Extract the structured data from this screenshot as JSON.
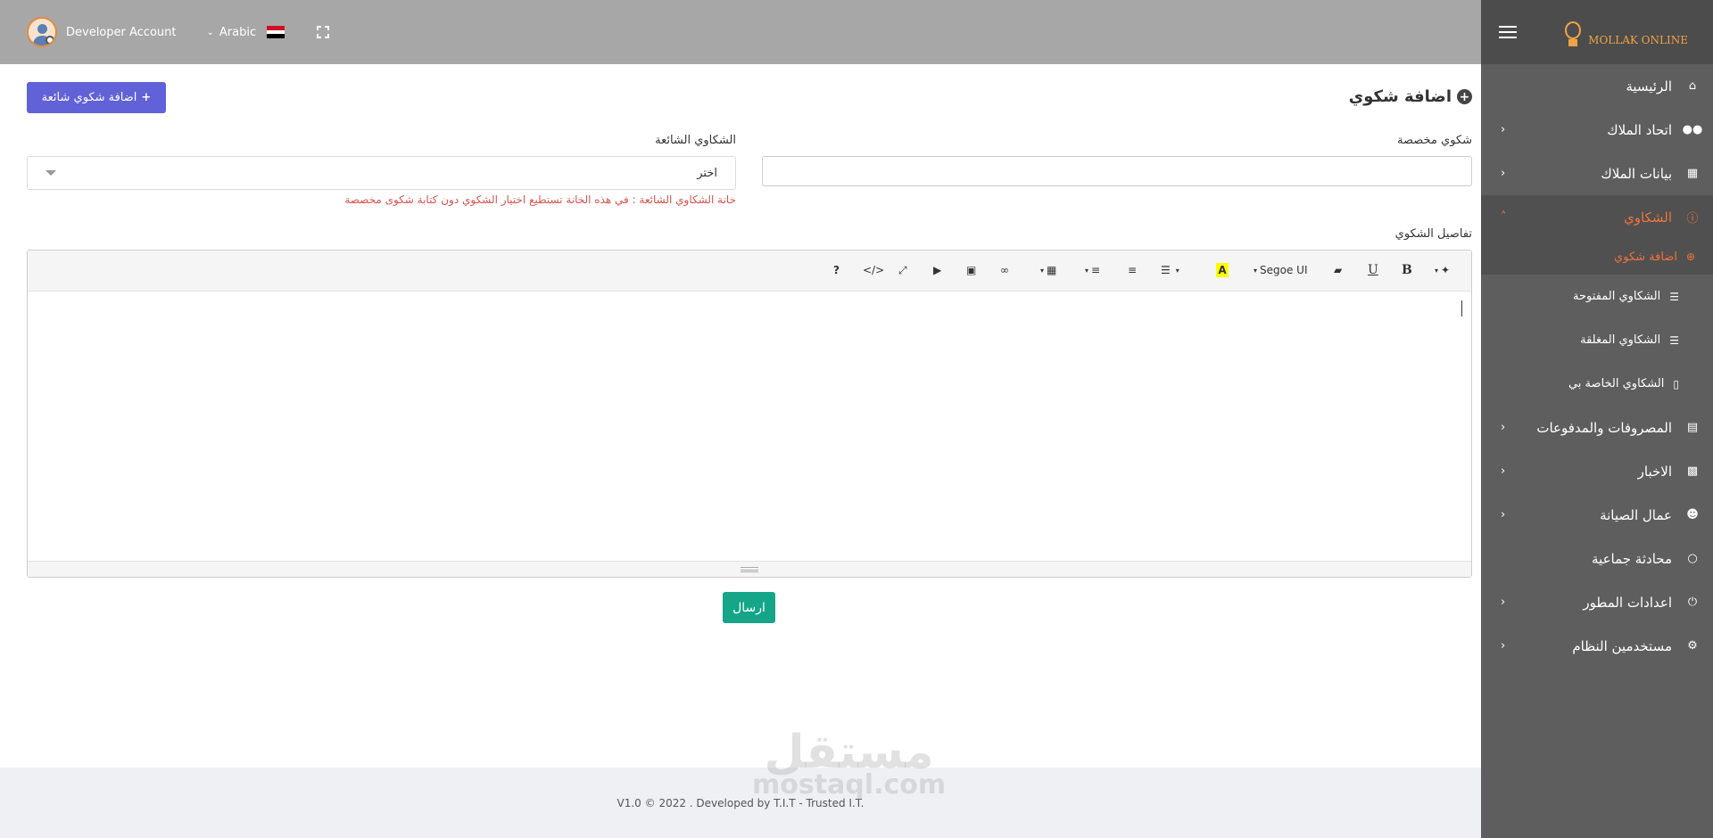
{
  "header": {
    "account_name": "Developer Account",
    "language": "Arabic",
    "icons": {
      "avatar": "user-avatar-icon",
      "flag": "egypt-flag-icon",
      "fullscreen": "fullscreen-icon"
    },
    "flag_colors": [
      "#ce1126",
      "#ffffff",
      "#000000"
    ]
  },
  "sidebar": {
    "logo_text": "MOLLAK ONLINE",
    "accent_color": "#f0733d",
    "items": [
      {
        "label": "الرئيسية",
        "icon": "home-icon",
        "has_children": false
      },
      {
        "label": "اتحاد الملاك",
        "icon": "users-icon",
        "has_children": true
      },
      {
        "label": "بيانات الملاك",
        "icon": "id-card-icon",
        "has_children": true
      },
      {
        "label": "الشكاوي",
        "icon": "alert-circle-icon",
        "has_children": true,
        "expanded": true
      },
      {
        "label": "المصروفات والمدفوعات",
        "icon": "money-icon",
        "has_children": true
      },
      {
        "label": "الاخبار",
        "icon": "newspaper-icon",
        "has_children": true
      },
      {
        "label": "عمال الصيانة",
        "icon": "user-icon",
        "has_children": true
      },
      {
        "label": "محادثة جماعية",
        "icon": "chat-icon",
        "has_children": false
      },
      {
        "label": "اعدادات المطور",
        "icon": "power-icon",
        "has_children": true
      },
      {
        "label": "مستخدمين النظام",
        "icon": "gear-icon",
        "has_children": true
      }
    ],
    "complaints_sub": [
      {
        "label": "اضافة شكوي",
        "icon": "plus-circle-icon",
        "current": true
      },
      {
        "label": "الشكاوي المفتوحة",
        "icon": "list-filter-icon"
      },
      {
        "label": "الشكاوي المغلقة",
        "icon": "list-filter-icon"
      },
      {
        "label": "الشكاوي الخاصة بي",
        "icon": "mouse-icon"
      }
    ]
  },
  "main": {
    "title": "اضافة شكوي",
    "add_common_button": "اضافة شكوي شائعة",
    "custom_label": "شكوي مخصصة",
    "custom_value": "",
    "common_label": "الشكاوي الشائعة",
    "common_selected": "اختر",
    "common_hint": "خانة الشكاوي الشائعة : في هذه الخانة تستطيع اختيار الشكوي دون كتابة شكوى مخصصة",
    "details_label": "تفاصيل الشكوي",
    "editor": {
      "font_name": "Segoe UI",
      "bold": "B",
      "underline": "U",
      "highlight": "A",
      "code": "</>",
      "help": "?"
    },
    "send_button": "ارسال"
  },
  "footer": {
    "text": "V1.0 © 2022 . Developed by T.I.T - Trusted I.T.",
    "watermark_ar": "مستقل",
    "watermark_en": "mostaql.com"
  }
}
